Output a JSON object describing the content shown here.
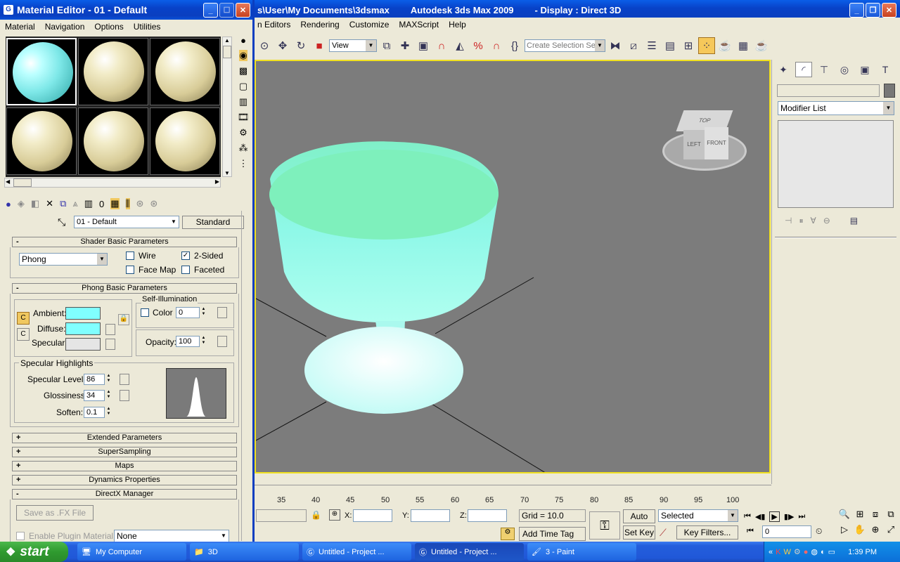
{
  "main_window": {
    "title_left": "s\\User\\My Documents\\3dsmax",
    "title_app": "Autodesk 3ds Max  2009",
    "title_display": "- Display : Direct 3D",
    "menu": [
      "n Editors",
      "Rendering",
      "Customize",
      "MAXScript",
      "Help"
    ],
    "toolbar": {
      "view_select": "View",
      "named_selection_placeholder": "Create Selection Set"
    }
  },
  "viewport": {
    "viewcube": {
      "top": "TOP",
      "left": "LEFT",
      "front": "FRONT"
    }
  },
  "command_panel": {
    "modifier_list": "Modifier List"
  },
  "timeline": {
    "ticks": [
      "35",
      "40",
      "45",
      "50",
      "55",
      "60",
      "65",
      "70",
      "75",
      "80",
      "85",
      "90",
      "95",
      "100"
    ]
  },
  "status_bar": {
    "x_label": "X:",
    "y_label": "Y:",
    "z_label": "Z:",
    "grid": "Grid = 10.0",
    "add_time_tag": "Add Time Tag",
    "auto_key": "Auto Key",
    "set_key": "Set Key",
    "selected": "Selected",
    "key_filters": "Key Filters...",
    "frame": "0"
  },
  "material_editor": {
    "title": "Material Editor - 01 - Default",
    "menu": [
      "Material",
      "Navigation",
      "Options",
      "Utilities"
    ],
    "material_name": "01 - Default",
    "material_type": "Standard",
    "shader_rollout": "Shader Basic Parameters",
    "shader_type": "Phong",
    "wire": "Wire",
    "two_sided": "2-Sided",
    "face_map": "Face Map",
    "faceted": "Faceted",
    "phong_rollout": "Phong Basic Parameters",
    "self_illum_group": "Self-Illumination",
    "color_label": "Color",
    "self_illum_value": "0",
    "ambient": "Ambient:",
    "diffuse": "Diffuse:",
    "specular": "Specular:",
    "opacity_label": "Opacity:",
    "opacity_value": "100",
    "spec_highlights": "Specular Highlights",
    "spec_level_label": "Specular Level:",
    "spec_level": "86",
    "glossiness_label": "Glossiness:",
    "glossiness": "34",
    "soften_label": "Soften:",
    "soften": "0.1",
    "ambient_color": "#80ffff",
    "diffuse_color": "#80ffff",
    "specular_color": "#e5e5e5",
    "rollouts": [
      {
        "sign": "+",
        "label": "Extended Parameters"
      },
      {
        "sign": "+",
        "label": "SuperSampling"
      },
      {
        "sign": "+",
        "label": "Maps"
      },
      {
        "sign": "+",
        "label": "Dynamics Properties"
      },
      {
        "sign": "-",
        "label": "DirectX Manager"
      }
    ],
    "save_fx": "Save as .FX File",
    "enable_plugin": "Enable Plugin Material",
    "plugin_value": "None"
  },
  "taskbar": {
    "start": "start",
    "items": [
      {
        "label": "My Computer"
      },
      {
        "label": "3D"
      },
      {
        "label": "Untitled     - Project ..."
      },
      {
        "label": "Untitled     - Project ..."
      },
      {
        "label": "3 - Paint"
      }
    ],
    "clock": "1:39 PM"
  }
}
